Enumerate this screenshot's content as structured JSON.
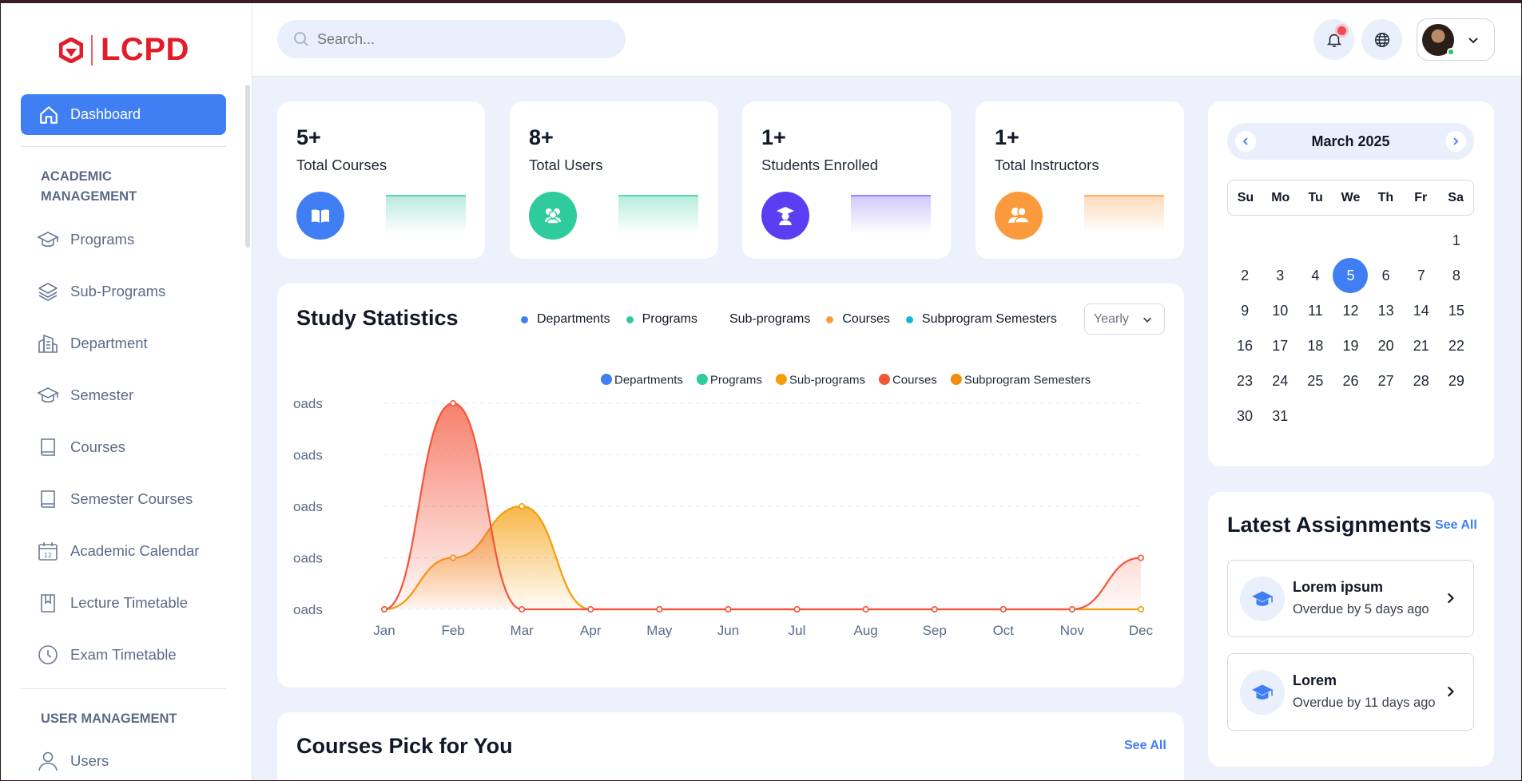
{
  "brand": {
    "name": "LCPD",
    "color": "#e11d2a"
  },
  "sidebar": {
    "active": {
      "label": "Dashboard",
      "icon": "home-icon"
    },
    "sections": [
      {
        "title": "ACADEMIC MANAGEMENT",
        "items": [
          {
            "label": "Programs",
            "icon": "graduation-cap-icon"
          },
          {
            "label": "Sub-Programs",
            "icon": "layers-icon"
          },
          {
            "label": "Department",
            "icon": "building-icon"
          },
          {
            "label": "Semester",
            "icon": "graduation-cap-icon"
          },
          {
            "label": "Courses",
            "icon": "book-icon"
          },
          {
            "label": "Semester Courses",
            "icon": "book-icon"
          },
          {
            "label": "Academic Calendar",
            "icon": "calendar-icon"
          },
          {
            "label": "Lecture Timetable",
            "icon": "bookmark-book-icon"
          },
          {
            "label": "Exam Timetable",
            "icon": "clock-icon"
          }
        ]
      },
      {
        "title": "USER MANAGEMENT",
        "items": [
          {
            "label": "Users",
            "icon": "user-icon"
          }
        ]
      }
    ]
  },
  "header": {
    "search_placeholder": "Search...",
    "notification_icon": "bell-icon",
    "language_icon": "globe-icon"
  },
  "stats": [
    {
      "value": "5+",
      "label": "Total Courses",
      "icon": "book-open-icon",
      "color": "#3f7ff3",
      "spark": "#38c3a0"
    },
    {
      "value": "8+",
      "label": "Total Users",
      "icon": "users-icon",
      "color": "#2fcb9c",
      "spark": "#2fcb9c"
    },
    {
      "value": "1+",
      "label": "Students Enrolled",
      "icon": "student-icon",
      "color": "#5b3df2",
      "spark": "#7c63f5"
    },
    {
      "value": "1+",
      "label": "Total Instructors",
      "icon": "instructors-icon",
      "color": "#fb9a3c",
      "spark": "#fb9a3c"
    }
  ],
  "study": {
    "title": "Study Statistics",
    "legend": [
      {
        "label": "Departments",
        "color": "#3f7ff3"
      },
      {
        "label": "Programs",
        "color": "#2fcb9c"
      },
      {
        "label": "Sub-programs",
        "color": "#ffffff"
      },
      {
        "label": "Courses",
        "color": "#fb9a3c"
      },
      {
        "label": "Subprogram Semesters",
        "color": "#14b8d4"
      }
    ],
    "period": "Yearly"
  },
  "chart_data": {
    "type": "area",
    "x": [
      "Jan",
      "Feb",
      "Mar",
      "Apr",
      "May",
      "Jun",
      "Jul",
      "Aug",
      "Sep",
      "Oct",
      "Nov",
      "Dec"
    ],
    "y_tick_labels": [
      "oads",
      "oads",
      "oads",
      "oads",
      "oads"
    ],
    "ylim": [
      0,
      4
    ],
    "legend": [
      {
        "label": "Departments",
        "color": "#3f7ff3"
      },
      {
        "label": "Programs",
        "color": "#2fcb9c"
      },
      {
        "label": "Sub-programs",
        "color": "#f59e0b"
      },
      {
        "label": "Courses",
        "color": "#f4553b"
      },
      {
        "label": "Subprogram Semesters",
        "color": "#f28c0f"
      }
    ],
    "series": [
      {
        "name": "Courses",
        "color": "#f4553b",
        "values": [
          0,
          4,
          0,
          0,
          0,
          0,
          0,
          0,
          0,
          0,
          0,
          1
        ]
      },
      {
        "name": "Subprogram Semesters",
        "color": "#f59e0b",
        "values": [
          0,
          1,
          2,
          0,
          0,
          0,
          0,
          0,
          0,
          0,
          0,
          0
        ]
      }
    ],
    "grid": true,
    "legend_position": "top-right"
  },
  "calendar": {
    "title": "March 2025",
    "weekdays": [
      "Su",
      "Mo",
      "Tu",
      "We",
      "Th",
      "Fr",
      "Sa"
    ],
    "leading_blanks": 6,
    "days": 31,
    "today": 5
  },
  "assignments": {
    "title": "Latest Assignments",
    "see_all": "See All",
    "items": [
      {
        "name": "Lorem ipsum",
        "status": "Overdue by 5 days ago"
      },
      {
        "name": "Lorem",
        "status": "Overdue by 11 days ago"
      }
    ]
  },
  "courses_pick": {
    "title": "Courses Pick for You",
    "see_all": "See All"
  }
}
